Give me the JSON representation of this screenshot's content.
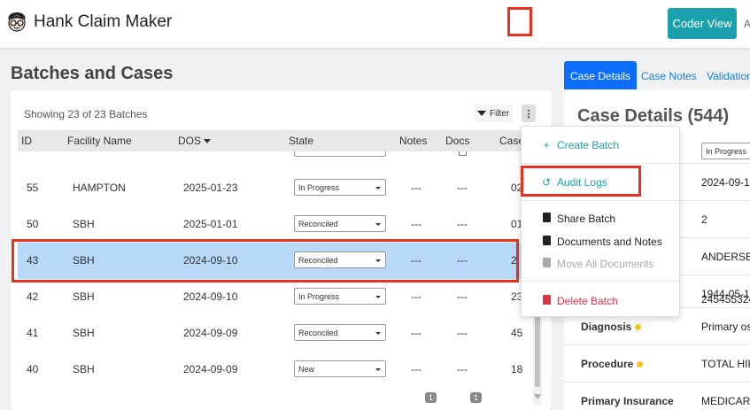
{
  "app": {
    "title": "Hank Claim Maker",
    "coder_view": "Coder View",
    "trailing": "A"
  },
  "batches": {
    "title": "Batches and Cases",
    "showing": "Showing 23 of 23 Batches",
    "filter": "Filter",
    "kebab": "⋮",
    "columns": {
      "id": "ID",
      "facility": "Facility Name",
      "dos": "DOS",
      "state": "State",
      "notes": "Notes",
      "docs": "Docs",
      "cases": "Case"
    },
    "rows": [
      {
        "id": "55",
        "facility": "HAMPTON",
        "dos": "2025-01-23",
        "state": "In Progress",
        "notes": "---",
        "docs": "---",
        "cases": "02"
      },
      {
        "id": "50",
        "facility": "SBH",
        "dos": "2025-01-01",
        "state": "Reconciled",
        "notes": "---",
        "docs": "---",
        "cases": "01"
      },
      {
        "id": "43",
        "facility": "SBH",
        "dos": "2024-09-10",
        "state": "Reconciled",
        "notes": "---",
        "docs": "---",
        "cases": "2"
      },
      {
        "id": "42",
        "facility": "SBH",
        "dos": "2024-09-10",
        "state": "In Progress",
        "notes": "---",
        "docs": "---",
        "cases": "23"
      },
      {
        "id": "41",
        "facility": "SBH",
        "dos": "2024-09-09",
        "state": "Reconciled",
        "notes": "---",
        "docs": "---",
        "cases": "45"
      },
      {
        "id": "40",
        "facility": "SBH",
        "dos": "2024-09-09",
        "state": "New",
        "notes": "---",
        "docs": "---",
        "cases": "18"
      }
    ],
    "badge_notes": "1",
    "badge_docs": "1"
  },
  "menu": {
    "create_batch": "Create Batch",
    "audit_logs": "Audit Logs",
    "share_batch": "Share Batch",
    "documents_notes": "Documents and Notes",
    "move_all": "Move All Documents",
    "delete_batch": "Delete Batch"
  },
  "case_panel": {
    "tabs": [
      "Case Details",
      "Case Notes",
      "Validation"
    ],
    "title": "Case Details (544)",
    "state_value": "In Progress",
    "values": [
      "2024-09-1",
      "2",
      "ANDERSEN",
      "1944-05-1",
      "245455324"
    ],
    "fields": [
      {
        "label": "Diagnosis",
        "value": "Primary os",
        "dot": true
      },
      {
        "label": "Procedure",
        "value": "TOTAL HIP",
        "dot": true
      },
      {
        "label": "Primary Insurance",
        "value": "MEDICARE",
        "dot": false
      }
    ]
  }
}
